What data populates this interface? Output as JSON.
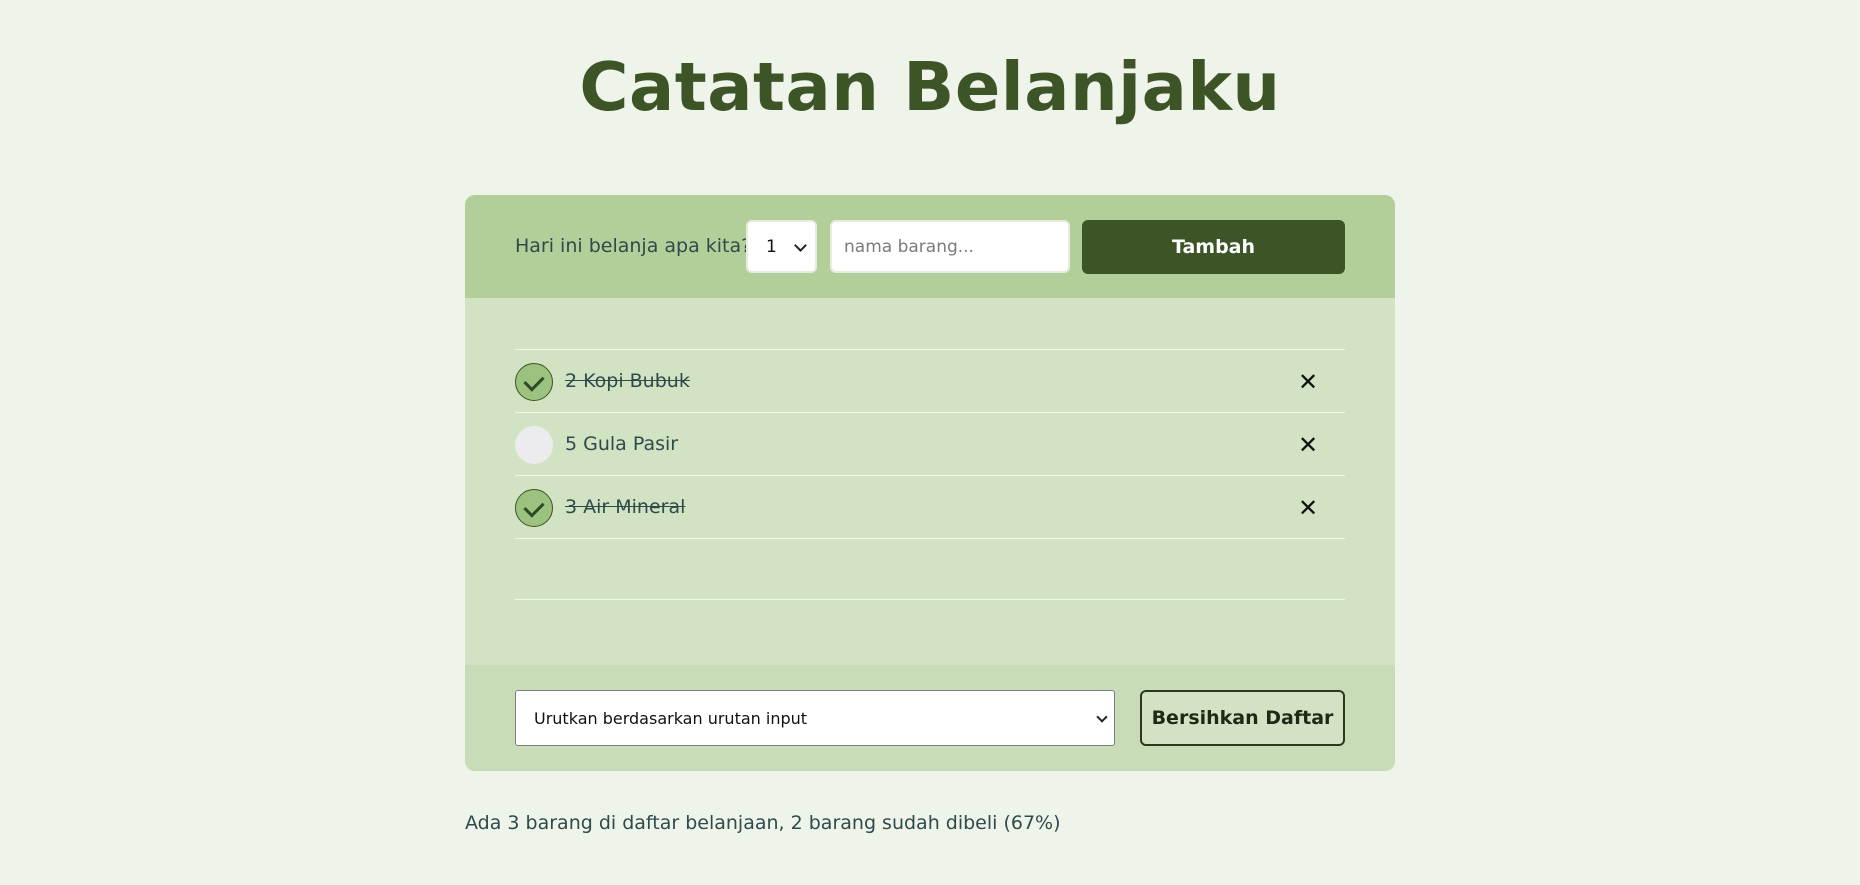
{
  "app": {
    "title": "Catatan Belanjaku"
  },
  "form": {
    "prompt": "Hari ini belanja apa kita?",
    "quantity_value": "1",
    "name_placeholder": "nama barang...",
    "add_label": "Tambah"
  },
  "items": [
    {
      "label": "2 Kopi Bubuk",
      "packed": true,
      "remove_icon": "✕"
    },
    {
      "label": "5 Gula Pasir",
      "packed": false,
      "remove_icon": "✕"
    },
    {
      "label": "3 Air Mineral",
      "packed": true,
      "remove_icon": "✕"
    }
  ],
  "footer": {
    "sort_value": "Urutkan berdasarkan urutan input",
    "clear_label": "Bersihkan Daftar"
  },
  "stats": {
    "text": "Ada 3 barang di daftar belanjaan, 2 barang sudah dibeli (67%)"
  },
  "colors": {
    "accent": "#3c5426",
    "header_bg": "#b2cf9a",
    "list_bg": "#d2e3c3",
    "page_bg": "#eff4ea"
  }
}
